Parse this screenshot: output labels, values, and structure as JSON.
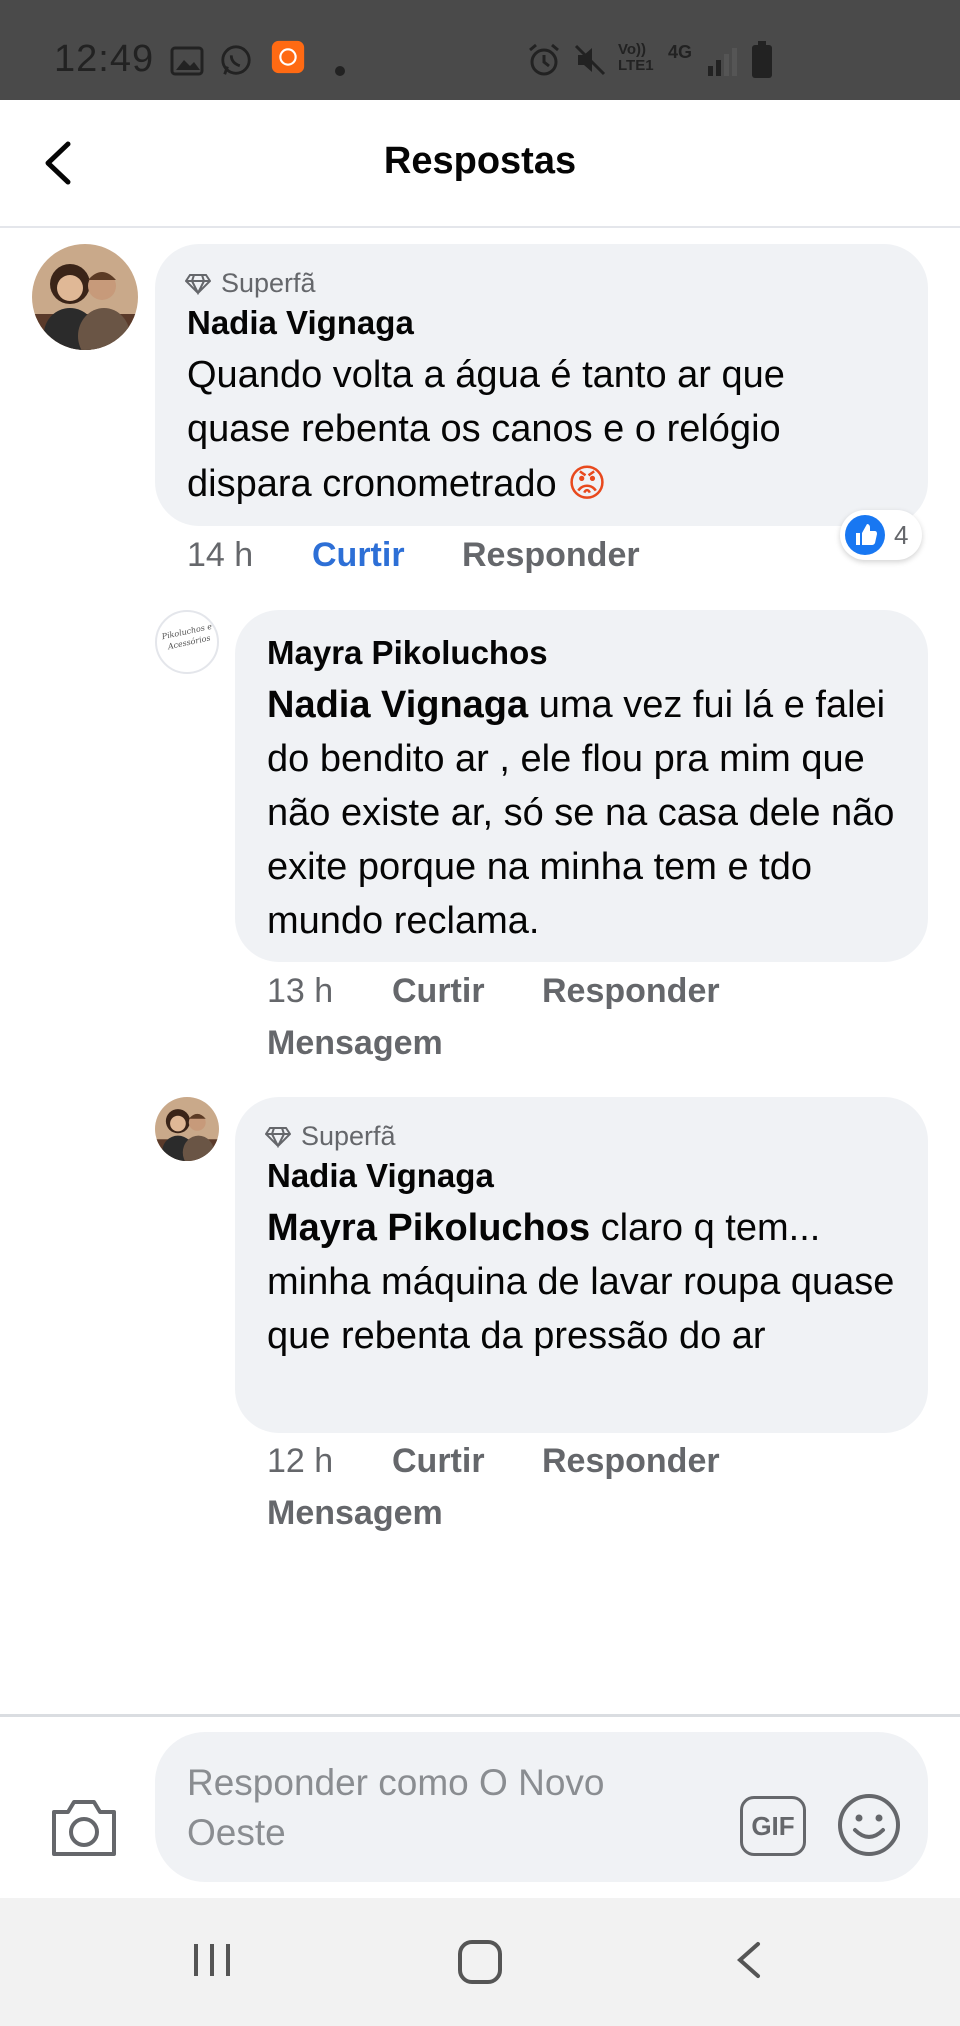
{
  "status_bar": {
    "time": "12:49",
    "notification_icons": [
      "gallery-icon",
      "whatsapp-icon",
      "app-notification-icon",
      "dot-icon"
    ],
    "system_icons": [
      "alarm-icon",
      "mute-icon",
      "volte-icon",
      "4g-icon",
      "signal-icon",
      "battery-icon"
    ],
    "volte_label": "Vo)) LTE1",
    "network_label": "4G"
  },
  "header": {
    "title": "Respostas"
  },
  "comments": [
    {
      "badge": "Superfã",
      "author": "Nadia Vignaga",
      "text": "Quando volta a água é tanto ar que quase rebenta os canos e o relógio dispara cronometrado",
      "emoji": "😡",
      "time": "14 h",
      "like_label": "Curtir",
      "reply_label": "Responder",
      "reaction_count": "4"
    },
    {
      "author": "Mayra Pikoluchos",
      "mention": "Nadia Vignaga",
      "text": " uma vez fui lá e falei do bendito ar , ele flou pra mim que não existe ar, só se na casa dele não exite porque na minha tem e tdo mundo reclama.",
      "time": "13 h",
      "like_label": "Curtir",
      "reply_label": "Responder",
      "message_label": "Mensagem",
      "avatar_text": "Pikoluchos e Acessórios"
    },
    {
      "badge": "Superfã",
      "author": "Nadia Vignaga",
      "mention": "Mayra Pikoluchos",
      "text": " claro q tem... minha máquina de lavar roupa quase que rebenta da pressão do ar",
      "time": "12 h",
      "like_label": "Curtir",
      "reply_label": "Responder",
      "message_label": "Mensagem"
    }
  ],
  "composer": {
    "placeholder": "Responder como O Novo Oeste",
    "gif_label": "GIF"
  },
  "colors": {
    "bubble": "#f0f2f5",
    "link_blue": "#2d6fd6",
    "muted": "#65676b",
    "status_bar": "#4a4a4a"
  }
}
